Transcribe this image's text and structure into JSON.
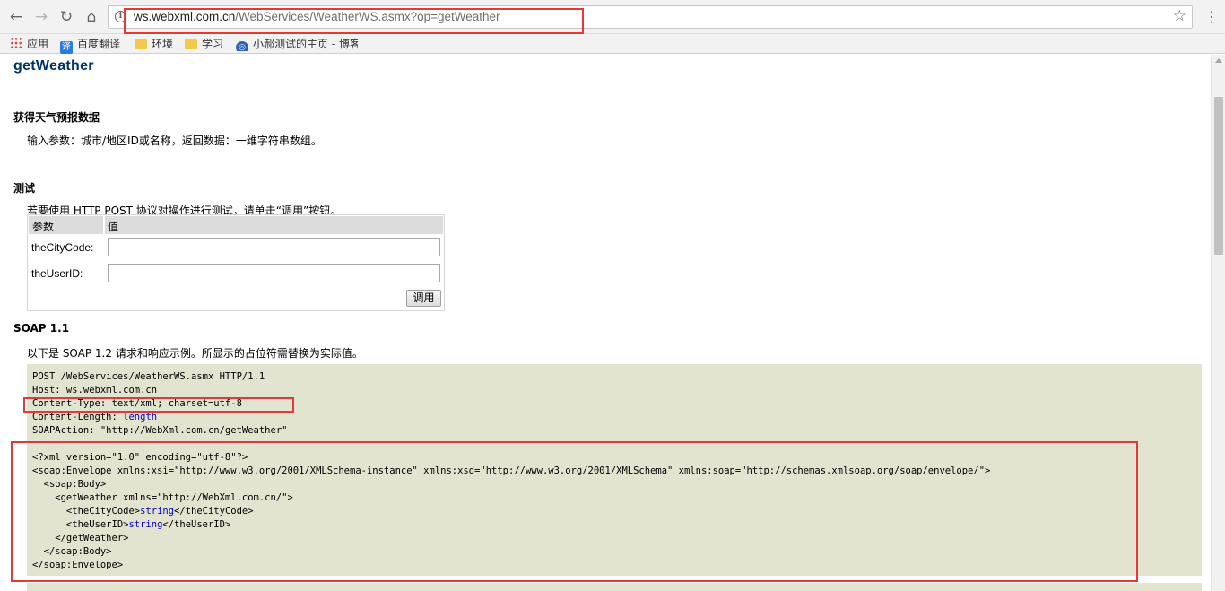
{
  "browser": {
    "url_host": "ws.webxml.com.cn",
    "url_path": "/WebServices/WeatherWS.asmx?op=getWeather",
    "bookmarks": [
      {
        "label": "应用",
        "icon": "apps-grid-icon"
      },
      {
        "label": "百度翻译",
        "icon": "translate-icon",
        "glyph": "译"
      },
      {
        "label": "环境",
        "icon": "folder-icon"
      },
      {
        "label": "学习",
        "icon": "folder-icon"
      },
      {
        "label": "小郝测试的主页 - 博客",
        "icon": "blog-icon"
      }
    ]
  },
  "page": {
    "title": "getWeather",
    "section_desc_heading": "获得天气预报数据",
    "section_desc_text": "输入参数：城市/地区ID或名称，返回数据：一维字符串数组。",
    "test_heading": "测试",
    "test_instruction": "若要使用 HTTP POST 协议对操作进行测试，请单击“调用”按钮。",
    "table_header_param": "参数",
    "table_header_value": "值",
    "params": [
      {
        "name": "theCityCode:",
        "value": ""
      },
      {
        "name": "theUserID:",
        "value": ""
      }
    ],
    "invoke_label": "调用",
    "soap_heading": "SOAP 1.1",
    "soap_instruction": "以下是 SOAP 1.2 请求和响应示例。所显示的占位符需替换为实际值。",
    "request_headers": [
      "POST /WebServices/WeatherWS.asmx HTTP/1.1",
      "Host: ws.webxml.com.cn",
      "Content-Type: text/xml; charset=utf-8",
      "Content-Length: ",
      "SOAPAction: \"http://WebXml.com.cn/getWeather\""
    ],
    "content_length_placeholder": "length",
    "xml_lines": [
      "<?xml version=\"1.0\" encoding=\"utf-8\"?>",
      "<soap:Envelope xmlns:xsi=\"http://www.w3.org/2001/XMLSchema-instance\" xmlns:xsd=\"http://www.w3.org/2001/XMLSchema\" xmlns:soap=\"http://schemas.xmlsoap.org/soap/envelope/\">",
      "  <soap:Body>",
      "    <getWeather xmlns=\"http://WebXml.com.cn/\">",
      "      <theCityCode>",
      "      <theUserID>",
      "    </getWeather>",
      "  </soap:Body>",
      "</soap:Envelope>"
    ],
    "city_close": "</theCityCode>",
    "user_close": "</theUserID>",
    "string_placeholder": "string"
  },
  "colors": {
    "highlight": "#e53935",
    "code_bg": "#e3e4cf",
    "title": "#003366"
  }
}
